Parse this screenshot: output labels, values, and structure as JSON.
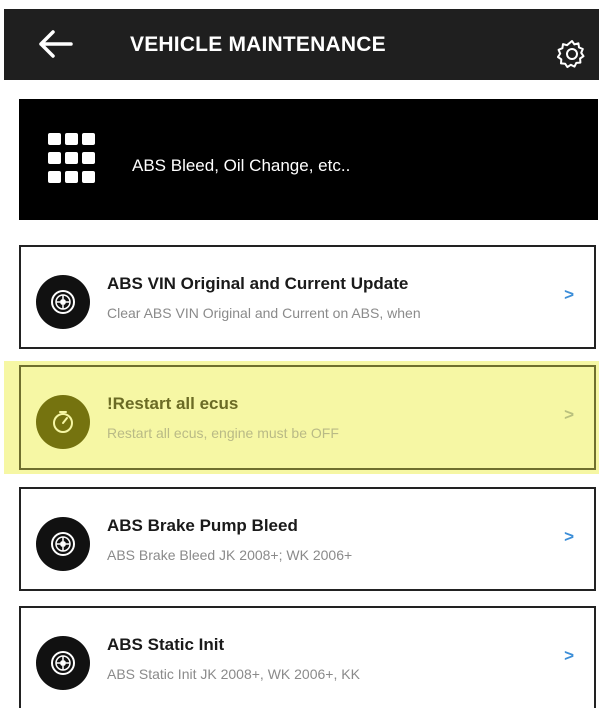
{
  "header": {
    "title": "VEHICLE MAINTENANCE",
    "back_icon": "arrow-left-icon",
    "settings_icon": "gear-icon"
  },
  "banner": {
    "icon": "grid-icon",
    "text": "ABS Bleed, Oil Change, etc.."
  },
  "items": [
    {
      "title": "ABS VIN Original and Current Update",
      "subtitle": "Clear ABS VIN Original and Current on ABS, when",
      "chevron": ">",
      "icon": "wheel-icon"
    },
    {
      "title": "!Restart all ecus",
      "subtitle": "Restart all ecus, engine must be OFF",
      "chevron": ">",
      "icon": "stopwatch-icon",
      "highlighted": true
    },
    {
      "title": "ABS Brake Pump Bleed",
      "subtitle": "ABS Brake Bleed JK 2008+; WK 2006+",
      "chevron": ">",
      "icon": "wheel-icon"
    },
    {
      "title": "ABS Static Init",
      "subtitle": "ABS Static Init JK 2008+, WK 2006+, KK",
      "chevron": ">",
      "icon": "wheel-icon"
    }
  ],
  "colors": {
    "header_bg": "#1f1f1f",
    "banner_bg": "#000000",
    "highlight_bg": "#f6f7a4",
    "chevron": "#3c8ed8"
  }
}
